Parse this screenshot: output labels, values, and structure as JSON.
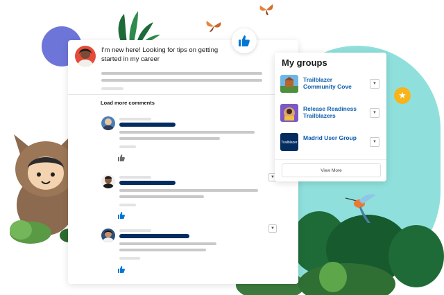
{
  "post": {
    "text": "I'm new here! Looking for tips on getting started in my career"
  },
  "comments": {
    "load_more": "Load more comments"
  },
  "groups": {
    "title": "My groups",
    "items": [
      {
        "name": "Trailblazer Community Cove",
        "thumb_color": "#3f8fd1"
      },
      {
        "name": "Release Readiness Trailblazers",
        "thumb_color": "#6c4fbf"
      },
      {
        "name": "Madrid User Group",
        "thumb_color": "#032d60",
        "thumb_text": "Trailblazer"
      }
    ],
    "view_more": "View More"
  },
  "colors": {
    "link": "#0b5cab",
    "navy": "#032d60",
    "teal_blob": "#8fe0dc",
    "purple_blob": "#6e75d9",
    "star": "#f9b31b",
    "like": "#0176d3"
  },
  "icons": [
    "thumbs-up-icon",
    "star-icon",
    "chevron-down-icon"
  ]
}
